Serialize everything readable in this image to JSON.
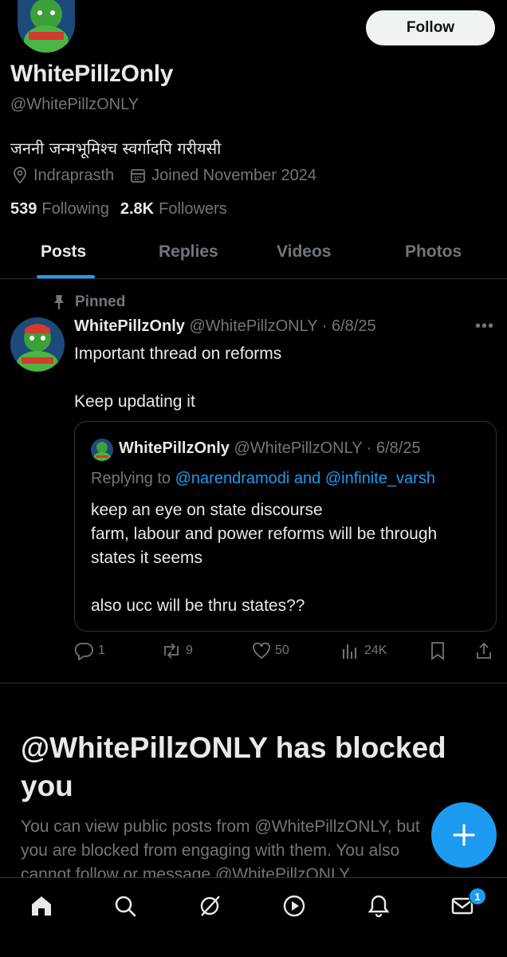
{
  "profile": {
    "display_name": "WhitePillzOnly",
    "handle": "@WhitePillzONLY",
    "bio": "जननी जन्मभूमिश्च स्वर्गादपि गरीयसी",
    "location": "Indraprasth",
    "joined": "Joined November 2024",
    "following_count": "539",
    "following_label": "Following",
    "followers_count": "2.8K",
    "followers_label": "Followers",
    "follow_button": "Follow"
  },
  "tabs": [
    {
      "label": "Posts",
      "active": true
    },
    {
      "label": "Replies",
      "active": false
    },
    {
      "label": "Videos",
      "active": false
    },
    {
      "label": "Photos",
      "active": false
    }
  ],
  "post": {
    "pinned_label": "Pinned",
    "author": "WhitePillzOnly",
    "handle_date": "@WhitePillzONLY · 6/8/25",
    "text_line1": "Important thread on reforms",
    "text_line2": "Keep updating it",
    "quote": {
      "author": "WhitePillzOnly",
      "handle_date": "@WhitePillzONLY · 6/8/25",
      "replying_prefix": "Replying to",
      "replying_to": "@narendramodi and @infinite_varsh",
      "line1": "keep an eye on state discourse",
      "line2": "farm, labour and power reforms will be through",
      "line3": "states it seems",
      "line4": "also ucc will be thru states??"
    },
    "actions": {
      "replies": "1",
      "reposts": "9",
      "likes": "50",
      "views": "24K"
    }
  },
  "blocked": {
    "title_line1": "@WhitePillzONLY has blocked",
    "title_line2": "you",
    "text_line1": "You can view public posts from @WhitePillzONLY, but",
    "text_line2": "you are blocked from engaging with them. You also",
    "text_line3": "cannot follow or message @WhitePillzONLY."
  },
  "nav": {
    "items": [
      "home-icon",
      "search-icon",
      "grok-icon",
      "video-icon",
      "notifications-icon",
      "messages-icon"
    ],
    "messages_badge": "1"
  },
  "colors": {
    "background": "#000000",
    "accent": "#1d9bf0",
    "text": "#e7e9ea",
    "secondary": "#71767b",
    "border": "#2f3336"
  }
}
